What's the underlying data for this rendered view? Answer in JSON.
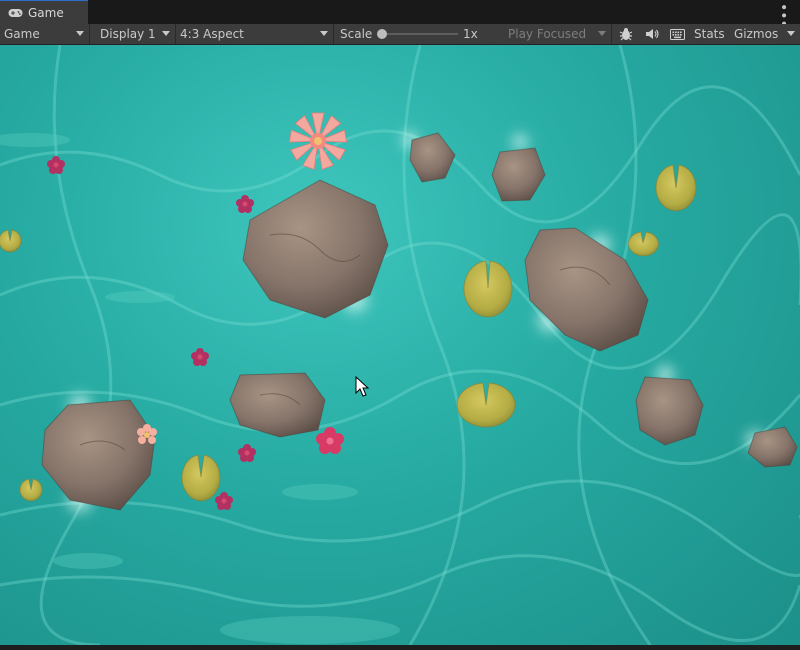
{
  "tab": {
    "label": "Game",
    "icon": "gamepad-icon"
  },
  "toolbar": {
    "mode": "Game",
    "display": "Display 1",
    "aspect": "4:3 Aspect",
    "scale_label": "Scale",
    "scale_value": "1x",
    "scale_fraction": 0.0,
    "play_mode": "Play Focused",
    "stats": "Stats",
    "gizmos": "Gizmos"
  },
  "colors": {
    "water": "#28b0a8",
    "rock": "#8a7868",
    "lily_pad": "#b8b04a",
    "lotus_pink": "#f29a94",
    "flower_magenta": "#b8305a",
    "accent_tab": "#2d6fc9"
  }
}
